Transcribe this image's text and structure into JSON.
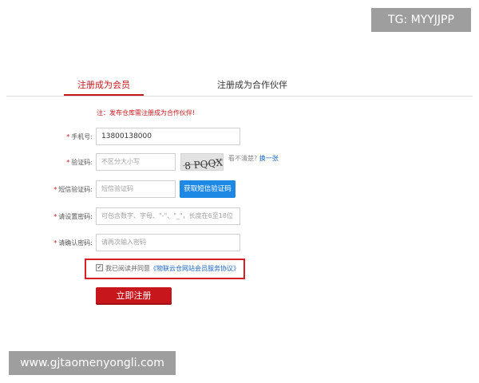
{
  "watermarks": {
    "top_right": "TG: MYYJJPP",
    "bottom_left": "www.gjtaomenyongli.com"
  },
  "tabs": [
    {
      "label": "注册成为会员",
      "active": true
    },
    {
      "label": "注册成为合作伙伴",
      "active": false
    }
  ],
  "notice": "注：发布仓库需注册成为合作伙伴!",
  "form": {
    "required_mark": "*",
    "phone": {
      "label": "手机号:",
      "value": "13800138000"
    },
    "captcha": {
      "label": "验证码:",
      "placeholder": "不区分大小写",
      "image_text": "8 PQQX",
      "hint": "看不清楚?",
      "refresh_label": "换一张"
    },
    "sms": {
      "label": "短信验证码:",
      "placeholder": "短信验证码",
      "button_label": "获取短信验证码"
    },
    "password": {
      "label": "请设置密码:",
      "placeholder": "可包含数字、字母、\"-\"、\"_\"，长度在6至18位"
    },
    "confirm_password": {
      "label": "请确认密码:",
      "placeholder": "请再次输入密码"
    },
    "agreement": {
      "checked": true,
      "text": "我已阅读并同意",
      "link": "《物联云仓网站会员服务协议》"
    },
    "submit_label": "立即注册"
  },
  "colors": {
    "brand_red": "#c8161d",
    "link_blue": "#1a66c2",
    "button_blue": "#1e88e5"
  }
}
